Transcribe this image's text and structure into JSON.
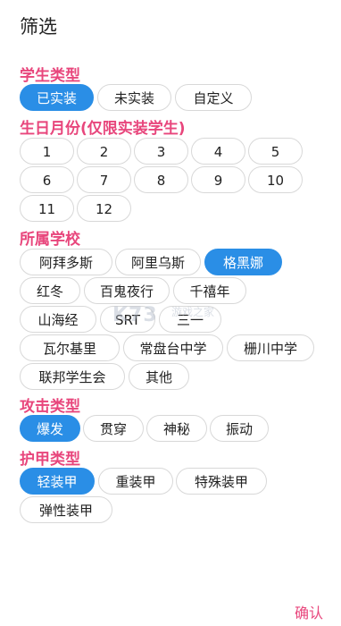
{
  "header": {
    "title": "筛选"
  },
  "sections": {
    "student_type": {
      "label": "学生类型",
      "options": [
        "已实装",
        "未实装",
        "自定义"
      ],
      "selected": "已实装"
    },
    "birthday_month": {
      "label": "生日月份(仅限实装学生)",
      "options": [
        "1",
        "2",
        "3",
        "4",
        "5",
        "6",
        "7",
        "8",
        "9",
        "10",
        "11",
        "12"
      ],
      "selected": null
    },
    "school": {
      "label": "所属学校",
      "options": [
        "阿拜多斯",
        "阿里乌斯",
        "格黑娜",
        "红冬",
        "百鬼夜行",
        "千禧年",
        "山海经",
        "SRT",
        "三一",
        "瓦尔基里",
        "常盘台中学",
        "栅川中学",
        "联邦学生会",
        "其他"
      ],
      "selected": "格黑娜"
    },
    "attack_type": {
      "label": "攻击类型",
      "options": [
        "爆发",
        "贯穿",
        "神秘",
        "振动"
      ],
      "selected": "爆发"
    },
    "armor_type": {
      "label": "护甲类型",
      "options": [
        "轻装甲",
        "重装甲",
        "特殊装甲",
        "弹性装甲"
      ],
      "selected": "轻装甲"
    }
  },
  "footer": {
    "confirm_label": "确认"
  },
  "watermark": {
    "text": "K73",
    "sub": "游戏之家"
  },
  "colors": {
    "accent": "#e8467c",
    "selected": "#2a8ee6"
  }
}
